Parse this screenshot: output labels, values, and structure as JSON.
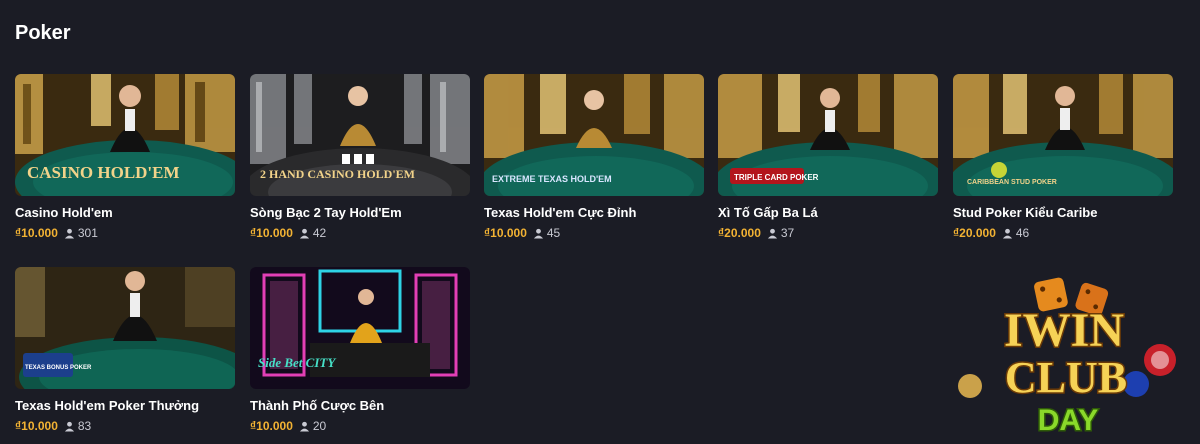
{
  "section": {
    "title": "Poker",
    "corner_text": ""
  },
  "games": [
    {
      "title": "Casino Hold'em",
      "price": "₫10.000",
      "players": "301",
      "thumb_text": "CASINO HOLD'EM",
      "scene": "gold",
      "icon": "user-icon"
    },
    {
      "title": "Sòng Bạc 2 Tay Hold'Em",
      "price": "₫10.000",
      "players": "42",
      "thumb_text": "2 HAND CASINO HOLD'EM",
      "scene": "silver",
      "icon": "user-icon"
    },
    {
      "title": "Texas Hold'em Cực Đỉnh",
      "price": "₫10.000",
      "players": "45",
      "thumb_text": "EXTREME TEXAS HOLD'EM",
      "scene": "gold",
      "icon": "user-icon"
    },
    {
      "title": "Xì Tố Gấp Ba Lá",
      "price": "₫20.000",
      "players": "37",
      "thumb_text": "TRIPLE CARD POKER",
      "scene": "gold",
      "icon": "user-icon"
    },
    {
      "title": "Stud Poker Kiểu Caribe",
      "price": "₫20.000",
      "players": "46",
      "thumb_text": "CARIBBEAN STUD POKER",
      "scene": "gold",
      "icon": "user-icon"
    },
    {
      "title": "Texas Hold'em Poker Thưởng",
      "price": "₫10.000",
      "players": "83",
      "thumb_text": "TEXAS BONUS POKER",
      "scene": "dark",
      "icon": "user-icon"
    },
    {
      "title": "Thành Phố Cược Bên",
      "price": "₫10.000",
      "players": "20",
      "thumb_text": "Side Bet CITY",
      "scene": "neon",
      "icon": "user-icon"
    }
  ],
  "watermark": {
    "line1": "IWIN",
    "line2": "CLUB",
    "line3": "DAY"
  },
  "colors": {
    "background": "#1b1c25",
    "price": "#f2b233",
    "players": "#c9cad3",
    "table": "#0f5a4e"
  }
}
